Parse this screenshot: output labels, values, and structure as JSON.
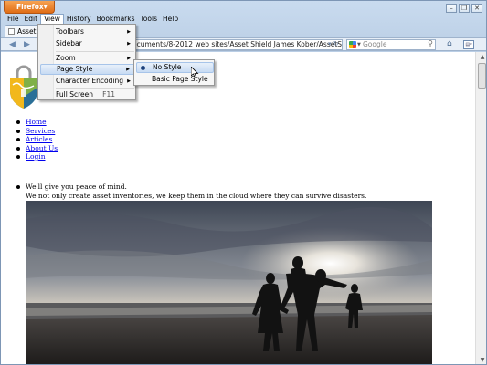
{
  "app_button": {
    "label": "Firefox"
  },
  "window_controls": {
    "minimize": "–",
    "restore": "❐",
    "close": "✕"
  },
  "menubar": [
    "File",
    "Edit",
    "View",
    "History",
    "Bookmarks",
    "Tools",
    "Help"
  ],
  "tab": {
    "title": "Asset M"
  },
  "navbar": {
    "url": "ocuments/8-2012 web sites/Asset Shield James Kober/AssetSh",
    "search_placeholder": "Google"
  },
  "view_menu": {
    "items": [
      {
        "label": "Toolbars",
        "submenu": true
      },
      {
        "label": "Sidebar",
        "submenu": true
      },
      {
        "label": "Zoom",
        "submenu": true
      },
      {
        "label": "Page Style",
        "submenu": true
      },
      {
        "label": "Character Encoding",
        "submenu": true
      },
      {
        "label": "Full Screen",
        "shortcut": "F11"
      }
    ]
  },
  "page_style_menu": {
    "items": [
      {
        "label": "No Style",
        "selected": true
      },
      {
        "label": "Basic Page Style",
        "selected": false
      }
    ]
  },
  "site_nav": [
    "Home",
    "Services",
    "Articles",
    "About Us",
    "Login"
  ],
  "tagline": {
    "line1": "We'll give you peace of mind.",
    "line2": "We not only create asset inventories, we keep them in the cloud where they can survive disasters."
  },
  "colors": {
    "app_button": "#e8771d",
    "link": "#0000ee",
    "menu_highlight": "#c7dbf3"
  }
}
